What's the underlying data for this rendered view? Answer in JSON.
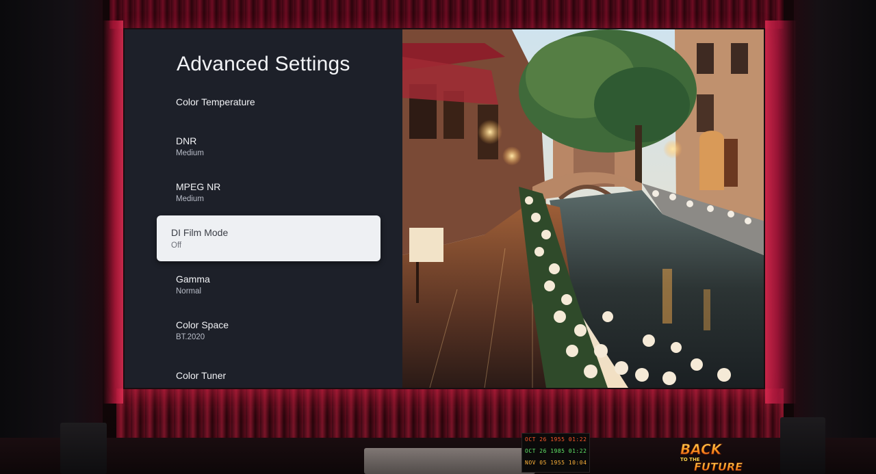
{
  "settings": {
    "title": "Advanced Settings",
    "items": [
      {
        "label": "Color Temperature",
        "value": ""
      },
      {
        "label": "DNR",
        "value": "Medium"
      },
      {
        "label": "MPEG NR",
        "value": "Medium"
      },
      {
        "label": "DI Film Mode",
        "value": "Off",
        "selected": true
      },
      {
        "label": "Gamma",
        "value": "Normal"
      },
      {
        "label": "Color Space",
        "value": "BT.2020"
      },
      {
        "label": "Color Tuner",
        "value": ""
      }
    ]
  },
  "room": {
    "time_circuits": [
      "OCT 26  1955  01:22",
      "OCT 26  1985  01:22",
      "NOV 05  1955  10:04"
    ],
    "poster_text": "BACK TO THE FUTURE"
  },
  "colors": {
    "panel_bg": "#1d2029",
    "selected_bg": "#eef0f3",
    "accent_glow": "#e03055"
  }
}
